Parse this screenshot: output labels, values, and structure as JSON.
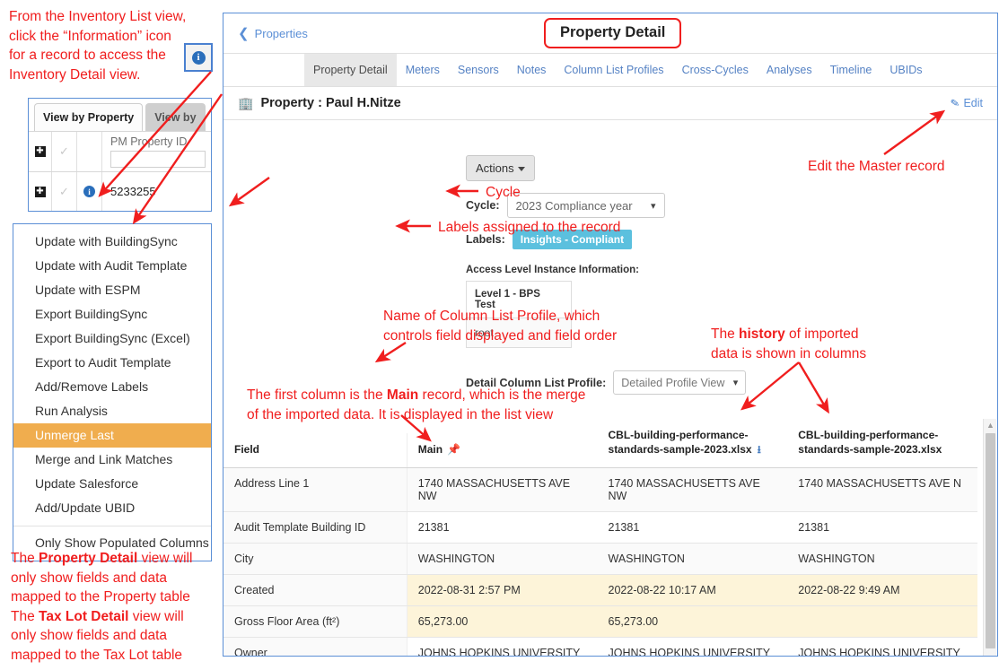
{
  "annotations": {
    "info_icon_note_l1": "From the Inventory List view,",
    "info_icon_note_l2": "click the “Information” icon",
    "info_icon_note_l3": "for a record to access the",
    "info_icon_note_l4": "Inventory Detail view.",
    "edit_master": "Edit the Master record",
    "cycle": "Cycle",
    "labels": "Labels assigned to the record",
    "clp_l1": "Name of Column List Profile, which",
    "clp_l2": "controls field displayed and field order",
    "history_l1_a": "The ",
    "history_l1_b": "history",
    "history_l1_c": " of imported",
    "history_l2": "data is shown in columns",
    "main_l1_a": "The first column is the ",
    "main_l1_b": "Main",
    "main_l1_c": " record, which is the merge",
    "main_l2": "of the imported data. It is displayed in the list view",
    "bottom_l1_a": "The ",
    "bottom_l1_b": "Property Detail",
    "bottom_l1_c": " view will",
    "bottom_l2": "only show fields and data",
    "bottom_l3": "mapped to the Property table",
    "bottom_l4_a": "The ",
    "bottom_l4_b": "Tax Lot Detail",
    "bottom_l4_c": " view will",
    "bottom_l5": "only show fields and data",
    "bottom_l6": "mapped to the Tax Lot table"
  },
  "inventory_list": {
    "tab_active": "View by Property",
    "tab_inactive": "View by",
    "column_header": "PM Property ID",
    "row_value": "5233255",
    "expand_glyph": "✚",
    "check_glyph": "✓",
    "info_glyph": "i"
  },
  "actions_menu": {
    "items": [
      {
        "label": "Update with BuildingSync",
        "highlighted": false
      },
      {
        "label": "Update with Audit Template",
        "highlighted": false
      },
      {
        "label": "Update with ESPM",
        "highlighted": false
      },
      {
        "label": "Export BuildingSync",
        "highlighted": false
      },
      {
        "label": "Export BuildingSync (Excel)",
        "highlighted": false
      },
      {
        "label": "Export to Audit Template",
        "highlighted": false
      },
      {
        "label": "Add/Remove Labels",
        "highlighted": false
      },
      {
        "label": "Run Analysis",
        "highlighted": false
      },
      {
        "label": "Unmerge Last",
        "highlighted": true
      },
      {
        "label": "Merge and Link Matches",
        "highlighted": false
      },
      {
        "label": "Update Salesforce",
        "highlighted": false
      },
      {
        "label": "Add/Update UBID",
        "highlighted": false
      }
    ],
    "footer_item": "Only Show Populated Columns",
    "highlight_color": "#f0ad4e"
  },
  "app": {
    "breadcrumb": "Properties",
    "page_title": "Property Detail",
    "tabs": [
      {
        "label": "Property Detail",
        "active": true
      },
      {
        "label": "Meters",
        "active": false
      },
      {
        "label": "Sensors",
        "active": false
      },
      {
        "label": "Notes",
        "active": false
      },
      {
        "label": "Column List Profiles",
        "active": false
      },
      {
        "label": "Cross-Cycles",
        "active": false
      },
      {
        "label": "Analyses",
        "active": false
      },
      {
        "label": "Timeline",
        "active": false
      },
      {
        "label": "UBIDs",
        "active": false
      }
    ],
    "record_title": "Property : Paul H.Nitze",
    "edit_label": "Edit",
    "actions_button": "Actions",
    "cycle_label": "Cycle:",
    "cycle_value": "2023 Compliance year",
    "labels_label": "Labels:",
    "label_badge": "Insights - Compliant",
    "label_badge_color": "#5bc0de",
    "ali_title": "Access Level Instance Information:",
    "ali_column": "Level 1 - BPS Test",
    "ali_value": "root",
    "dclp_label": "Detail Column List Profile:",
    "dclp_value": "Detailed Profile View"
  },
  "table": {
    "headers": [
      {
        "label": "Field",
        "pinned": false,
        "download": false
      },
      {
        "label": "Main",
        "pinned": true,
        "download": false
      },
      {
        "label": "CBL-building-performance-standards-sample-2023.xlsx",
        "pinned": false,
        "download": true
      },
      {
        "label": "CBL-building-performance-standards-sample-2023.xlsx",
        "pinned": false,
        "download": false
      }
    ],
    "rows": [
      {
        "field": "Address Line 1",
        "values": [
          "1740 MASSACHUSETTS AVE NW",
          "1740 MASSACHUSETTS AVE NW",
          "1740 MASSACHUSETTS AVE N"
        ],
        "shade": "grey"
      },
      {
        "field": "Audit Template Building ID",
        "values": [
          "21381",
          "21381",
          "21381"
        ],
        "shade": "white"
      },
      {
        "field": "City",
        "values": [
          "WASHINGTON",
          "WASHINGTON",
          "WASHINGTON"
        ],
        "shade": "grey"
      },
      {
        "field": "Created",
        "values": [
          "2022-08-31 2:57 PM",
          "2022-08-22 10:17 AM",
          "2022-08-22 9:49 AM"
        ],
        "shade": "yellow"
      },
      {
        "field": "Gross Floor Area (ft²)",
        "values": [
          "65,273.00",
          "65,273.00",
          ""
        ],
        "shade": "yellow"
      },
      {
        "field": "Owner",
        "values": [
          "JOHNS HOPKINS UNIVERSITY",
          "JOHNS HOPKINS UNIVERSITY",
          "JOHNS HOPKINS UNIVERSITY"
        ],
        "shade": "white"
      }
    ],
    "pin_glyph": "📌",
    "download_glyph": "⭳"
  }
}
